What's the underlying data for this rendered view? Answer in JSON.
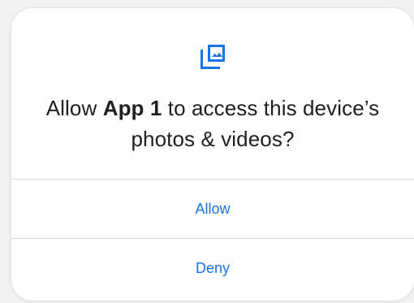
{
  "dialog": {
    "icon": "photo-library-icon",
    "title_prefix": "Allow ",
    "app_name": "App 1",
    "title_suffix": " to access this device’s photos & videos?",
    "accent_color": "#1a73e8",
    "buttons": {
      "allow_label": "Allow",
      "deny_label": "Deny"
    }
  }
}
